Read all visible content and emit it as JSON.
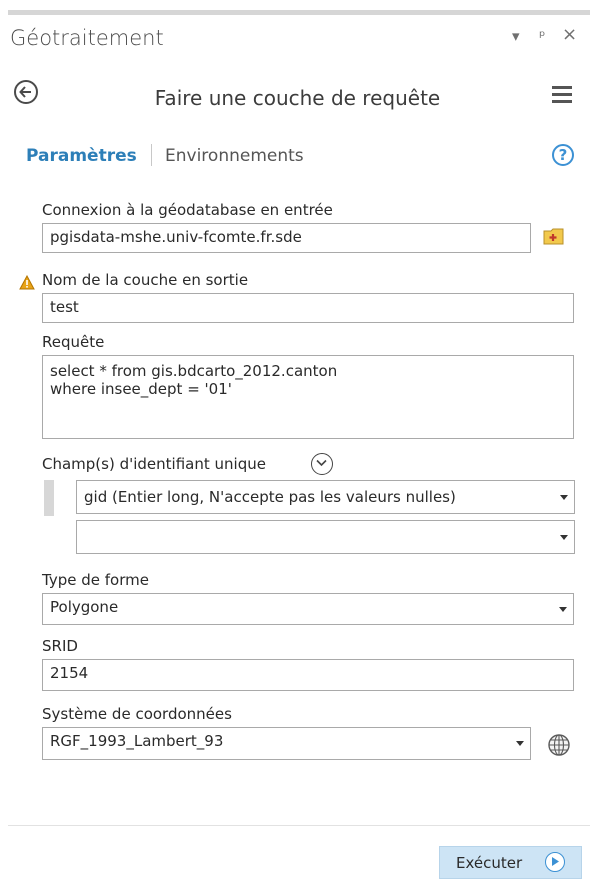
{
  "pane": {
    "title": "Géotraitement",
    "controls": [
      "▾",
      "ᵖ",
      "×"
    ]
  },
  "tool": {
    "title": "Faire une couche de requête"
  },
  "tabs": {
    "parameters": "Paramètres",
    "environments": "Environnements"
  },
  "form": {
    "connection": {
      "label": "Connexion à la géodatabase en entrée",
      "value": "pgisdata-mshe.univ-fcomte.fr.sde"
    },
    "output_layer": {
      "label": "Nom de la couche en sortie",
      "value": "test"
    },
    "query": {
      "label": "Requête",
      "lines": [
        "select * from gis.bdcarto_2012.canton",
        "where insee_dept = '01'"
      ]
    },
    "unique_id": {
      "label": "Champ(s) d'identifiant unique",
      "selected": "gid (Entier long, N'accepte pas les valeurs nulles)",
      "empty_value": ""
    },
    "shape_type": {
      "label": "Type de forme",
      "value": "Polygone"
    },
    "srid": {
      "label": "SRID",
      "value": "2154"
    },
    "coordinate_system": {
      "label": "Système de coordonnées",
      "value": "RGF_1993_Lambert_93"
    }
  },
  "footer": {
    "run_label": "Exécuter"
  },
  "colors": {
    "accent": "#2d7fb8",
    "run_button_bg": "#cde4f5",
    "warning": "#e8a317"
  }
}
